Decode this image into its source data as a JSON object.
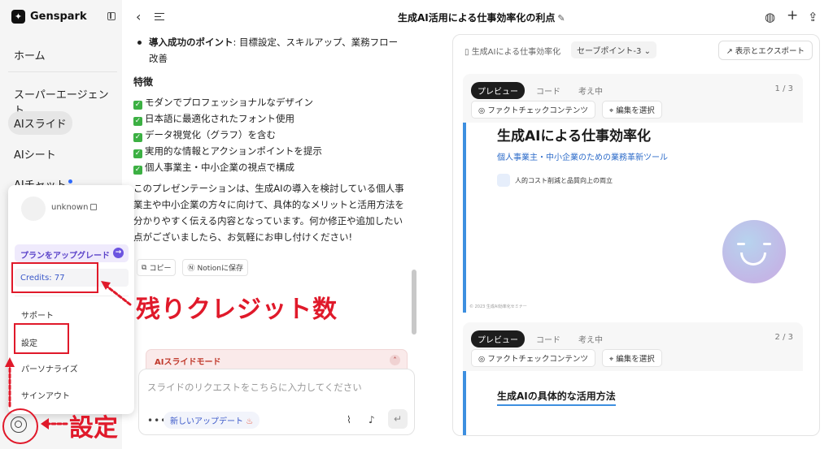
{
  "app": {
    "brand": "Genspark"
  },
  "sidebar": {
    "items": [
      {
        "label": "ホーム"
      },
      {
        "label": "スーパーエージェント"
      },
      {
        "label": "AIスライド"
      },
      {
        "label": "AIシート"
      },
      {
        "label": "AIチャット"
      }
    ]
  },
  "account_menu": {
    "username": "unknown",
    "upgrade_label": "プランをアップグレード",
    "credits_label": "Credits:  77",
    "items": [
      "サポート",
      "設定",
      "パーソナライズ",
      "サインアウト"
    ]
  },
  "topbar": {
    "title": "生成AI活用による仕事効率化の利点"
  },
  "chat": {
    "bullet_bold": "導入成功のポイント",
    "bullet_rest": ": 目標設定、スキルアップ、業務フロー改善",
    "section_title": "特徴",
    "features": [
      "モダンでプロフェッショナルなデザイン",
      "日本語に最適化されたフォント使用",
      "データ視覚化（グラフ）を含む",
      "実用的な情報とアクションポイントを提示",
      "個人事業主・中小企業の視点で構成"
    ],
    "summary": "このプレゼンテーションは、生成AIの導入を検討している個人事業主や中小企業の方々に向けて、具体的なメリットと活用方法を分かりやすく伝える内容となっています。何か修正や追加したい点がございましたら、お気軽にお申し付けください!",
    "copy_label": "コピー",
    "notion_label": "Notionに保存",
    "mode_banner": "AIスライドモード",
    "input_placeholder": "スライドのリクエストをこちらに入力してください",
    "update_label": "新しいアップデート"
  },
  "panel": {
    "doc_name": "生成AIによる仕事効率化",
    "savepoint": "セーブポイント-3",
    "export_label": "表示とエクスポート",
    "tabs": [
      "プレビュー",
      "コード",
      "考え中"
    ],
    "factcheck_label": "ファクトチェックコンテンツ",
    "edit_label": "編集を選択",
    "slides": [
      {
        "page": "1 / 3",
        "title": "生成AIによる仕事効率化",
        "subtitle": "個人事業主・中小企業のための業務革新ツール",
        "badge": "人的コスト削減と品質向上の両立",
        "copyright": "© 2023 生成AI効率化セミナー"
      },
      {
        "page": "2 / 3",
        "title": "生成AIの具体的な活用方法"
      }
    ]
  },
  "annotations": {
    "credits_note": "残りクレジット数",
    "settings_note": "設定"
  },
  "colors": {
    "annotation": "#e0192a",
    "accent": "#3d8fe0",
    "upgrade": "#6c54e0"
  }
}
